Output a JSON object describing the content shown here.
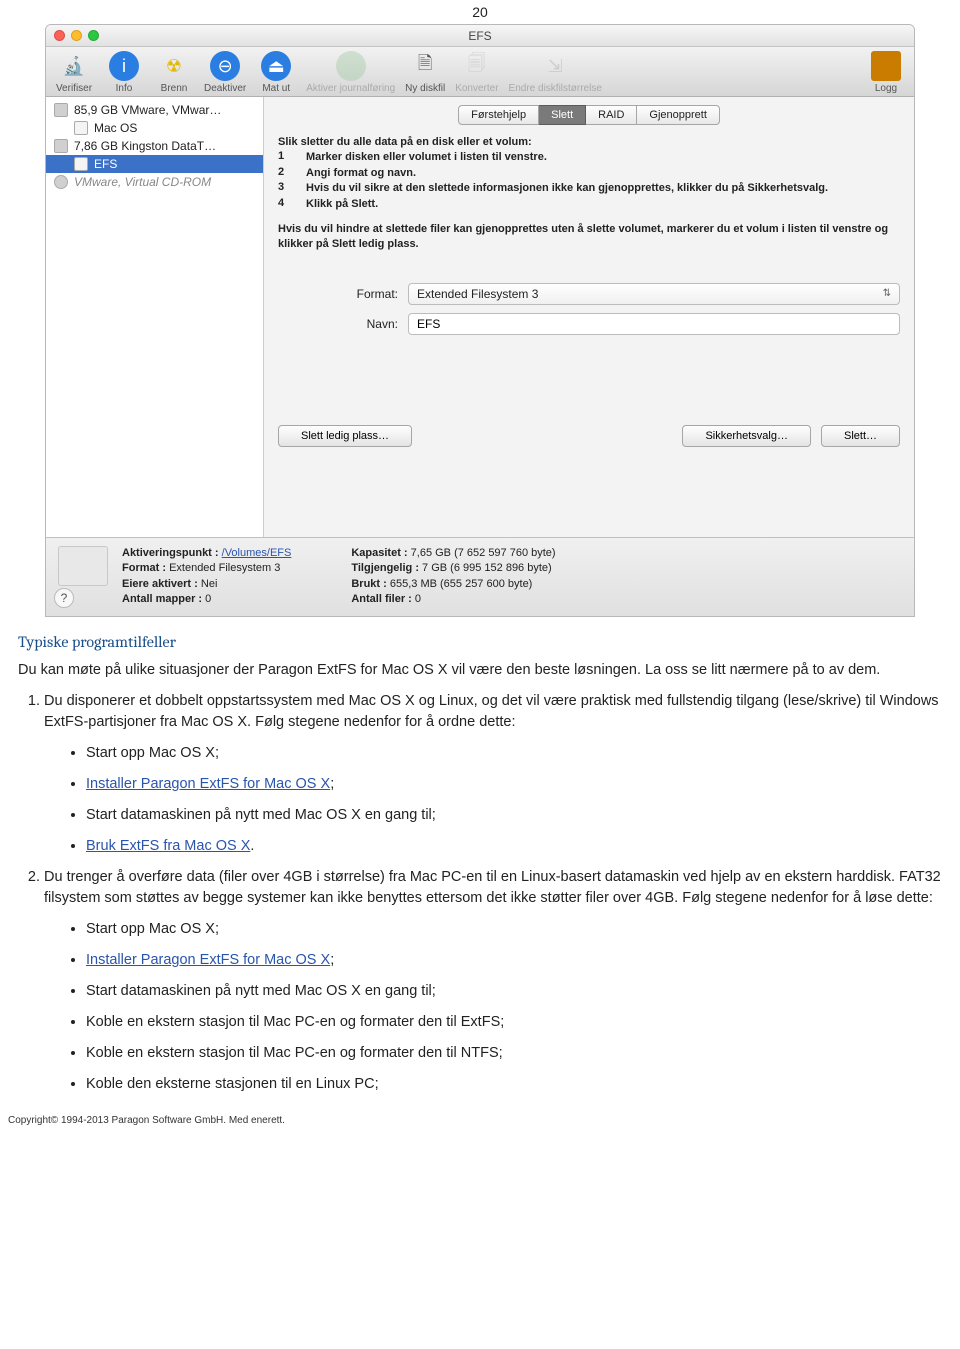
{
  "page_number": "20",
  "window": {
    "title": "EFS"
  },
  "toolbar": [
    {
      "name": "verifiser",
      "label": "Verifiser",
      "disabled": false
    },
    {
      "name": "info",
      "label": "Info",
      "disabled": false
    },
    {
      "name": "brenn",
      "label": "Brenn",
      "disabled": false
    },
    {
      "name": "deaktiver",
      "label": "Deaktiver",
      "disabled": false
    },
    {
      "name": "matut",
      "label": "Mat ut",
      "disabled": false
    },
    {
      "name": "aktiver",
      "label": "Aktiver journalføring",
      "disabled": true
    },
    {
      "name": "nydiskfil",
      "label": "Ny diskfil",
      "disabled": false
    },
    {
      "name": "konverter",
      "label": "Konverter",
      "disabled": true
    },
    {
      "name": "endre",
      "label": "Endre diskfilstørrelse",
      "disabled": true
    }
  ],
  "toolbar_right": {
    "name": "logg",
    "label": "Logg"
  },
  "sidebar": [
    {
      "label": "85,9 GB VMware, VMwar…",
      "type": "disk"
    },
    {
      "label": "Mac OS",
      "type": "vol",
      "indent": true
    },
    {
      "label": "7,86 GB Kingston DataT…",
      "type": "disk"
    },
    {
      "label": "EFS",
      "type": "vol",
      "indent": true,
      "selected": true
    },
    {
      "label": "VMware, Virtual CD-ROM",
      "type": "dim",
      "italic": true
    }
  ],
  "tabs": [
    {
      "label": "Førstehjelp"
    },
    {
      "label": "Slett",
      "selected": true
    },
    {
      "label": "RAID"
    },
    {
      "label": "Gjenopprett"
    }
  ],
  "instructions": {
    "intro": "Slik sletter du alle data på en disk eller et volum:",
    "steps": [
      "Marker disken eller volumet i listen til venstre.",
      "Angi format og navn.",
      "Hvis du vil sikre at den slettede informasjonen ikke kan gjenopprettes, klikker du på Sikkerhetsvalg.",
      "Klikk på Slett."
    ],
    "note": "Hvis du vil hindre at slettede filer kan gjenopprettes uten å slette volumet, markerer du et volum i listen til venstre og klikker på Slett ledig plass."
  },
  "form": {
    "format_label": "Format:",
    "format_value": "Extended Filesystem 3",
    "name_label": "Navn:",
    "name_value": "EFS"
  },
  "buttons": {
    "slett_ledig": "Slett ledig plass…",
    "sikkerhet": "Sikkerhetsvalg…",
    "slett": "Slett…"
  },
  "info_left": {
    "aktiveringspunkt_label": "Aktiveringspunkt :",
    "aktiveringspunkt_value": "/Volumes/EFS",
    "format_label": "Format :",
    "format_value": "Extended Filesystem 3",
    "eiere_label": "Eiere aktivert :",
    "eiere_value": "Nei",
    "mapper_label": "Antall mapper :",
    "mapper_value": "0"
  },
  "info_right": {
    "kapasitet_label": "Kapasitet :",
    "kapasitet_value": "7,65 GB (7 652 597 760 byte)",
    "tilgjengelig_label": "Tilgjengelig :",
    "tilgjengelig_value": "7 GB (6 995 152 896 byte)",
    "brukt_label": "Brukt :",
    "brukt_value": "655,3 MB (655 257 600 byte)",
    "filer_label": "Antall filer :",
    "filer_value": "0"
  },
  "doc": {
    "heading": "Typiske programtilfeller",
    "intro": "Du kan møte på ulike situasjoner der Paragon ExtFS for Mac OS X vil være den beste løsningen. La oss se litt nærmere på to av dem.",
    "li1": "Du disponerer et dobbelt oppstartssystem med Mac OS X og Linux, og det vil være praktisk med fullstendig tilgang (lese/skrive) til Windows ExtFS-partisjoner fra Mac OS X. Følg stegene nedenfor for å ordne dette:",
    "li1_b1": "Start opp Mac OS X;",
    "li1_b2": "Installer Paragon ExtFS for Mac OS X",
    "li1_b2_suffix": ";",
    "li1_b3": "Start datamaskinen på nytt med Mac OS X en gang til;",
    "li1_b4": "Bruk ExtFS fra Mac OS X",
    "li1_b4_suffix": ".",
    "li2": "Du trenger å overføre data (filer over 4GB i størrelse) fra Mac PC-en til en Linux-basert datamaskin ved hjelp av en ekstern harddisk. FAT32 filsystem som støttes av begge systemer kan ikke benyttes ettersom det ikke støtter filer over 4GB. Følg stegene nedenfor for å løse dette:",
    "li2_b1": "Start opp Mac OS X;",
    "li2_b2": "Installer Paragon ExtFS for Mac OS X",
    "li2_b2_suffix": ";",
    "li2_b3": "Start datamaskinen på nytt med Mac OS X en gang til;",
    "li2_b4": "Koble en ekstern stasjon til Mac PC-en og formater den til ExtFS;",
    "li2_b5": "Koble en ekstern stasjon til Mac PC-en og formater den til NTFS;",
    "li2_b6": "Koble den eksterne stasjonen til en Linux PC;"
  },
  "copyright": "Copyright© 1994-2013 Paragon Software GmbH. Med enerett."
}
